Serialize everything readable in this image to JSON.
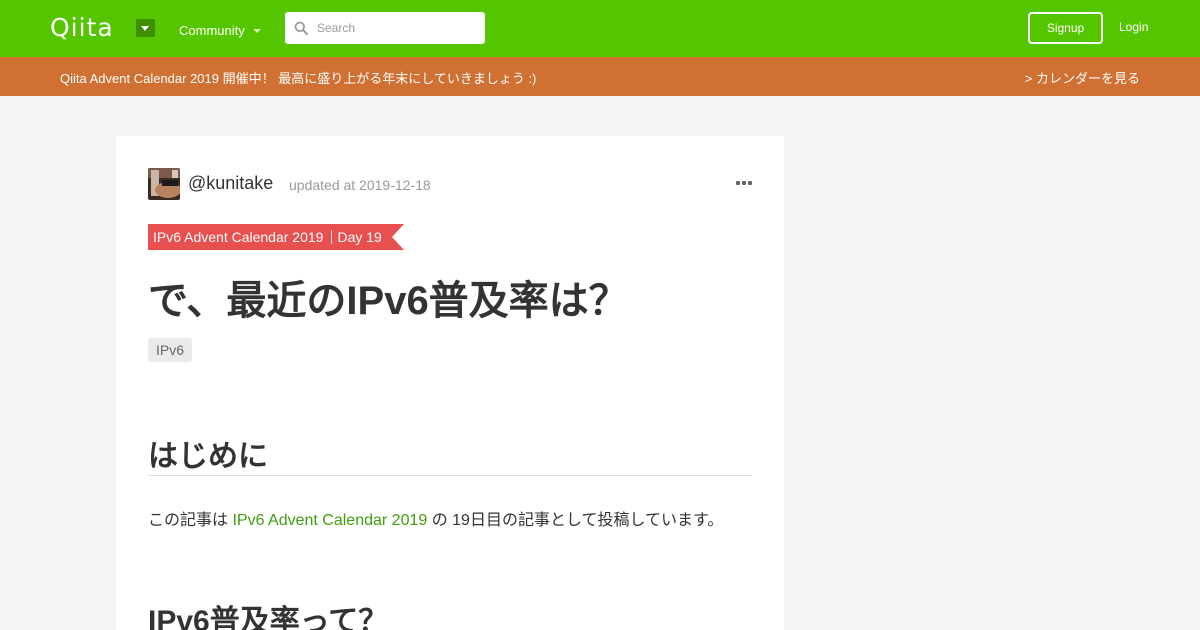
{
  "header": {
    "logo": "Qiita",
    "community_label": "Community",
    "search_placeholder": "Search",
    "signup_label": "Signup",
    "login_label": "Login",
    "colors": {
      "brand": "#55c500"
    }
  },
  "banner": {
    "text": "Qiita Advent Calendar 2019 開催中！ 最高に盛り上がる年末にしていきましょう :)",
    "link_label": "> カレンダーを見る",
    "color": "#d07133"
  },
  "article": {
    "author": "@kunitake",
    "updated": "updated at 2019-12-18",
    "calendar_name": "IPv6 Advent Calendar 2019",
    "calendar_day": "Day 19",
    "title": "で、最近のIPv6普及率は？",
    "tags": [
      "IPv6"
    ],
    "sections": [
      {
        "heading": "はじめに",
        "body_before": "この記事は ",
        "body_link": "IPv6 Advent Calendar 2019",
        "body_after": " の 19日目の記事として投稿しています。"
      },
      {
        "heading": "IPv6普及率って？"
      }
    ],
    "colors": {
      "ribbon": "#e85050",
      "link": "#3f9d0f"
    }
  }
}
